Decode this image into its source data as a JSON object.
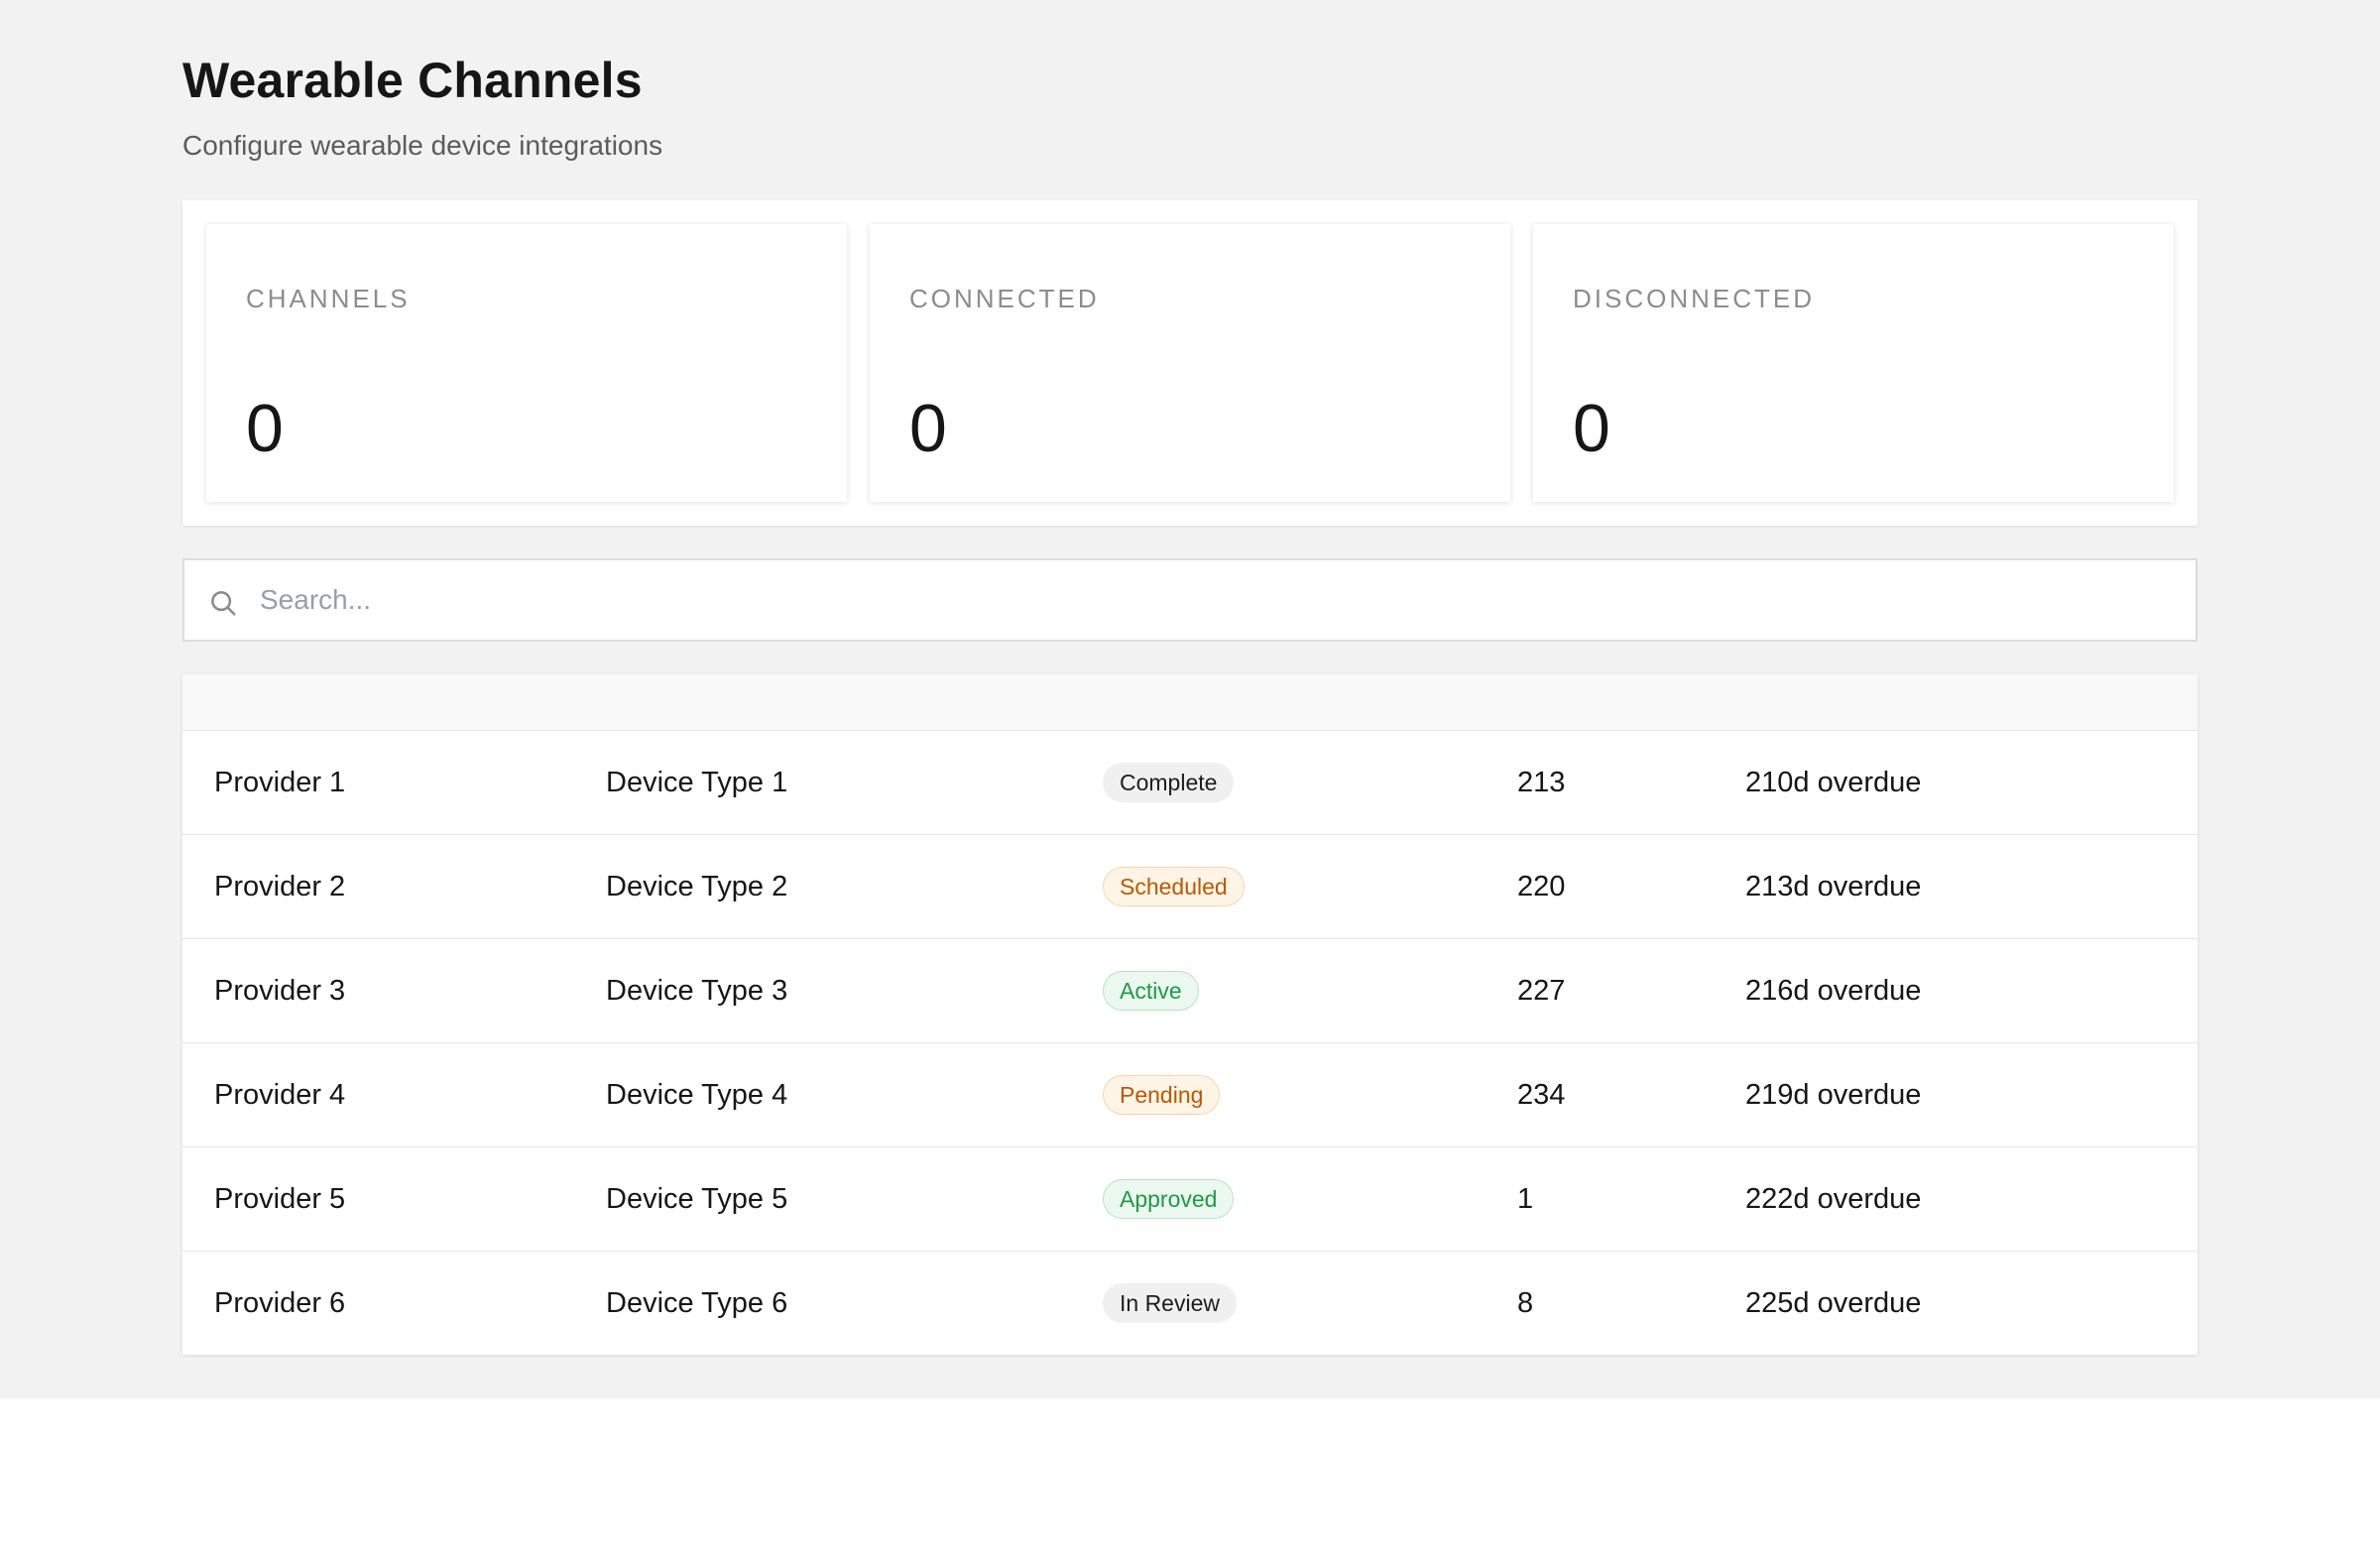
{
  "header": {
    "title": "Wearable Channels",
    "subtitle": "Configure wearable device integrations"
  },
  "stats": [
    {
      "label": "CHANNELS",
      "value": "0"
    },
    {
      "label": "CONNECTED",
      "value": "0"
    },
    {
      "label": "DISCONNECTED",
      "value": "0"
    }
  ],
  "search": {
    "placeholder": "Search...",
    "value": "",
    "icon": "search-icon"
  },
  "table": {
    "rows": [
      {
        "provider": "Provider 1",
        "device_type": "Device Type 1",
        "status": "Complete",
        "status_tone": "neutral",
        "count": "213",
        "due": "210d overdue"
      },
      {
        "provider": "Provider 2",
        "device_type": "Device Type 2",
        "status": "Scheduled",
        "status_tone": "warning",
        "count": "220",
        "due": "213d overdue"
      },
      {
        "provider": "Provider 3",
        "device_type": "Device Type 3",
        "status": "Active",
        "status_tone": "success",
        "count": "227",
        "due": "216d overdue"
      },
      {
        "provider": "Provider 4",
        "device_type": "Device Type 4",
        "status": "Pending",
        "status_tone": "warning",
        "count": "234",
        "due": "219d overdue"
      },
      {
        "provider": "Provider 5",
        "device_type": "Device Type 5",
        "status": "Approved",
        "status_tone": "success",
        "count": "1",
        "due": "222d overdue"
      },
      {
        "provider": "Provider 6",
        "device_type": "Device Type 6",
        "status": "In Review",
        "status_tone": "neutral",
        "count": "8",
        "due": "225d overdue"
      }
    ]
  },
  "colors": {
    "page_background": "#f2f2f2",
    "text_primary": "#161616",
    "text_muted": "#8c8c8c",
    "badge_neutral": "#f0f0f0",
    "badge_warning_text": "#b85a00",
    "badge_success_text": "#1f9a45"
  }
}
